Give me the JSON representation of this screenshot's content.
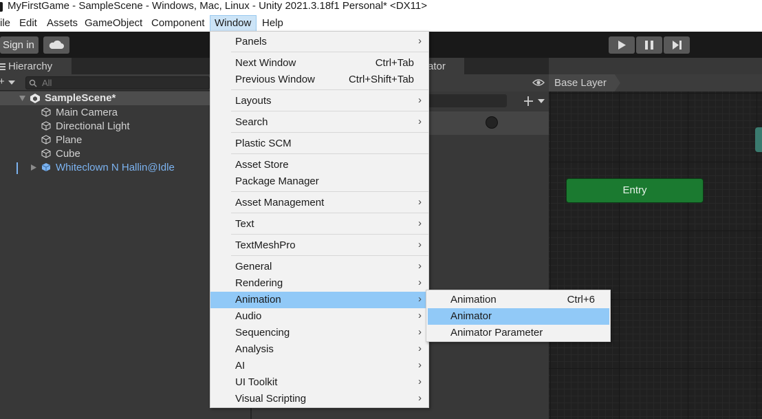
{
  "titlebar": {
    "title": "MyFirstGame - SampleScene - Windows, Mac, Linux - Unity 2021.3.18f1 Personal* <DX11>"
  },
  "menubar": {
    "items": [
      "ile",
      "Edit",
      "Assets",
      "GameObject",
      "Component",
      "Window",
      "Help"
    ],
    "active": "Window"
  },
  "toolbar": {
    "sign_in": "Sign in",
    "cloud_icon": "cloud-icon",
    "play_icon": "play-icon",
    "pause_icon": "pause-icon",
    "step_icon": "step-icon"
  },
  "hierarchy": {
    "tab_label": "Hierarchy",
    "add_label": "+",
    "search_placeholder": "All",
    "scene": "SampleScene*",
    "objects": [
      "Main Camera",
      "Directional Light",
      "Plane",
      "Cube"
    ],
    "prefab": "Whiteclown N Hallin@Idle"
  },
  "animator": {
    "tab_partial": "ator",
    "breadcrumb": "Base Layer",
    "entry_node": "Entry"
  },
  "window_menu": {
    "items": [
      {
        "label": "Panels",
        "submenu": true
      },
      {
        "label": "Next Window",
        "shortcut": "Ctrl+Tab"
      },
      {
        "label": "Previous Window",
        "shortcut": "Ctrl+Shift+Tab"
      },
      {
        "label": "Layouts",
        "submenu": true
      },
      {
        "label": "Search",
        "submenu": true
      },
      {
        "label": "Plastic SCM"
      },
      {
        "label": "Asset Store"
      },
      {
        "label": "Package Manager"
      },
      {
        "label": "Asset Management",
        "submenu": true
      },
      {
        "label": "Text",
        "submenu": true
      },
      {
        "label": "TextMeshPro",
        "submenu": true
      },
      {
        "label": "General",
        "submenu": true
      },
      {
        "label": "Rendering",
        "submenu": true
      },
      {
        "label": "Animation",
        "submenu": true,
        "highlighted": true
      },
      {
        "label": "Audio",
        "submenu": true
      },
      {
        "label": "Sequencing",
        "submenu": true
      },
      {
        "label": "Analysis",
        "submenu": true
      },
      {
        "label": "AI",
        "submenu": true
      },
      {
        "label": "UI Toolkit",
        "submenu": true
      },
      {
        "label": "Visual Scripting",
        "submenu": true
      }
    ],
    "arrow": "›"
  },
  "animation_submenu": {
    "items": [
      {
        "label": "Animation",
        "shortcut": "Ctrl+6"
      },
      {
        "label": "Animator",
        "highlighted": true
      },
      {
        "label": "Animator Parameter"
      }
    ]
  },
  "colors": {
    "menu_highlight": "#91c9f7",
    "entry_green": "#1b7a30",
    "prefab_blue": "#7cb3f0"
  }
}
